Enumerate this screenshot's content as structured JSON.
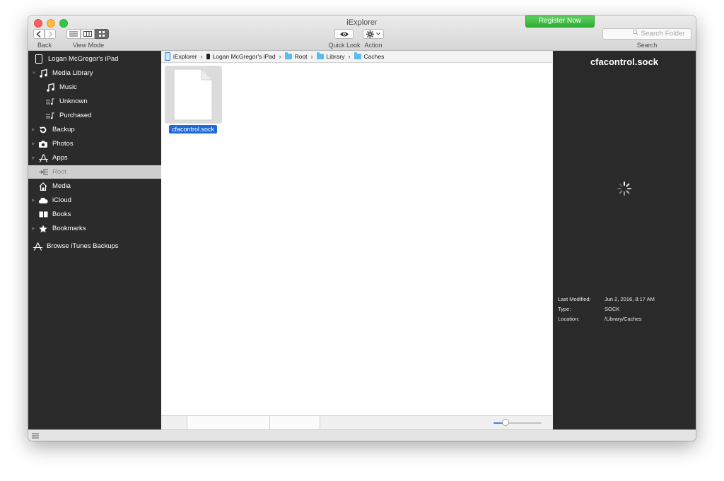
{
  "window": {
    "title": "iExplorer",
    "register_label": "Register Now"
  },
  "toolbar": {
    "back_label": "Back",
    "view_mode_label": "View Mode",
    "quick_look_label": "Quick Look",
    "action_label": "Action",
    "search_placeholder": "Search Folder",
    "search_label": "Search"
  },
  "sidebar": {
    "items": [
      {
        "label": "Logan McGregor's iPad",
        "icon": "ipad-icon"
      },
      {
        "label": "Media Library",
        "icon": "music-note-icon"
      },
      {
        "label": "Music",
        "icon": "music-note-icon"
      },
      {
        "label": "Unknown",
        "icon": "playlist-icon"
      },
      {
        "label": "Purchased",
        "icon": "playlist-icon"
      },
      {
        "label": "Backup",
        "icon": "backup-icon"
      },
      {
        "label": "Photos",
        "icon": "camera-icon"
      },
      {
        "label": "Apps",
        "icon": "app-store-icon"
      },
      {
        "label": "Root",
        "icon": "root-icon",
        "selected": true
      },
      {
        "label": "Media",
        "icon": "house-icon"
      },
      {
        "label": "iCloud",
        "icon": "cloud-icon"
      },
      {
        "label": "Books",
        "icon": "book-icon"
      },
      {
        "label": "Bookmarks",
        "icon": "star-icon"
      },
      {
        "label": "Browse iTunes Backups",
        "icon": "app-store-icon"
      }
    ]
  },
  "breadcrumb": {
    "items": [
      "iExplorer",
      "Logan McGregor's iPad",
      "Root",
      "Library",
      "Caches"
    ],
    "separator": "›"
  },
  "file": {
    "name": "cfacontrol.sock",
    "icon": "document-icon"
  },
  "inspector": {
    "title": "cfacontrol.sock",
    "meta": [
      {
        "key": "Last Modified:",
        "value": "Jun 2, 2016, 8:17 AM"
      },
      {
        "key": "Type:",
        "value": "SOCK"
      },
      {
        "key": "Location:",
        "value": "/Library/Caches"
      }
    ]
  },
  "zoom": {
    "value": 0.25
  },
  "colors": {
    "sidebar_bg": "#2b2b2b",
    "selection_blue": "#1f69d9",
    "register_green": "#3ab53e",
    "folder_blue": "#5bbcf0"
  }
}
